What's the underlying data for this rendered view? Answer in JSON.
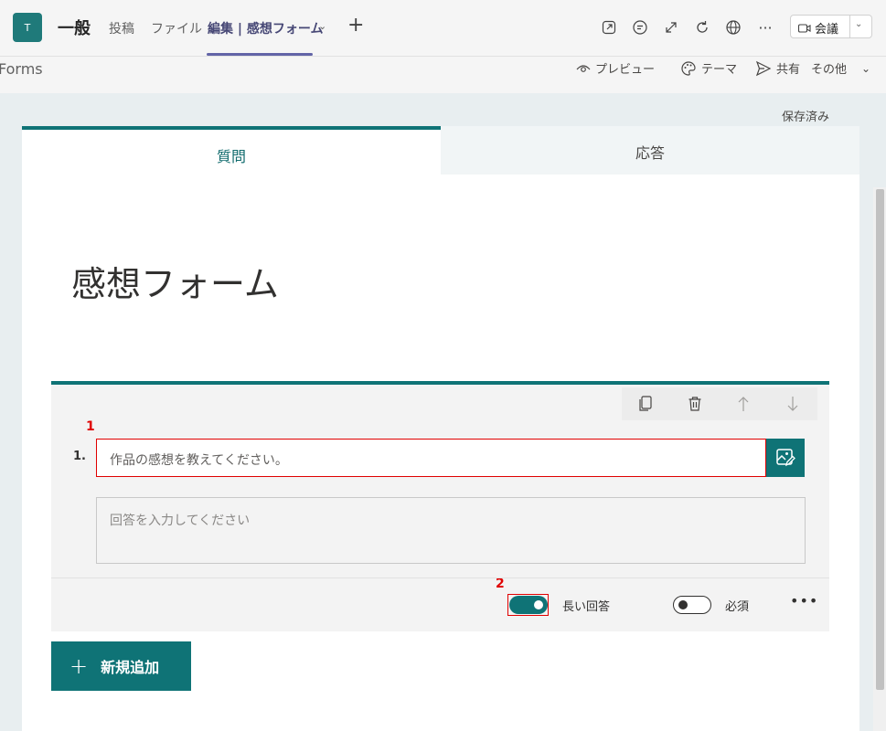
{
  "teams_header": {
    "avatar_letter": "T",
    "channel_name": "一般",
    "tabs": [
      {
        "label": "投稿"
      },
      {
        "label": "ファイル"
      },
      {
        "label": "編集 | 感想フォーム",
        "active": true
      }
    ],
    "icons": [
      "popout-icon",
      "chat-icon",
      "expand-icon",
      "reload-icon",
      "globe-icon",
      "more-icon"
    ],
    "meet_button_label": "会議"
  },
  "forms_toolbar": {
    "app_label": "Forms",
    "preview_label": "プレビュー",
    "theme_label": "テーマ",
    "share_label": "共有",
    "more_label": "その他"
  },
  "save_status": "保存済み",
  "form": {
    "tabs": [
      {
        "label": "質問",
        "active": true
      },
      {
        "label": "応答"
      }
    ],
    "title": "感想フォーム",
    "question": {
      "number": "1.",
      "text": "作品の感想を教えてください。",
      "answer_placeholder": "回答を入力してください",
      "long_answer_label": "長い回答",
      "long_answer_on": true,
      "required_label": "必須",
      "required_on": false
    },
    "add_new_label": "新規追加"
  },
  "annotations": {
    "first": "1",
    "second": "2"
  },
  "colors": {
    "accent": "#0f7376",
    "teams_purple": "#6264a7",
    "highlight_red": "#e00000"
  }
}
